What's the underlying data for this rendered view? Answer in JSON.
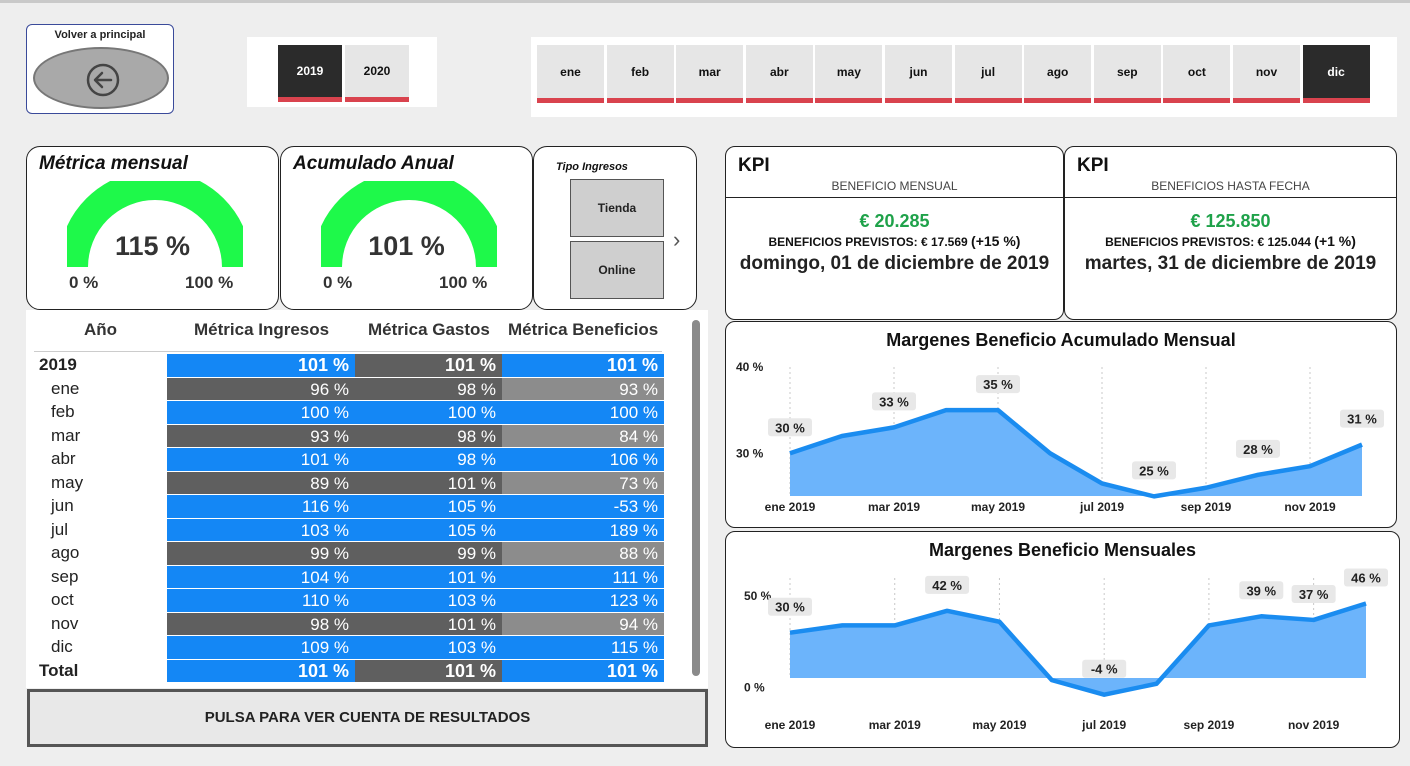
{
  "back": {
    "label": "Volver a principal"
  },
  "years": [
    {
      "label": "2019",
      "selected": true
    },
    {
      "label": "2020",
      "selected": false
    }
  ],
  "months": [
    {
      "label": "ene",
      "selected": false
    },
    {
      "label": "feb",
      "selected": false
    },
    {
      "label": "mar",
      "selected": false
    },
    {
      "label": "abr",
      "selected": false
    },
    {
      "label": "may",
      "selected": false
    },
    {
      "label": "jun",
      "selected": false
    },
    {
      "label": "jul",
      "selected": false
    },
    {
      "label": "ago",
      "selected": false
    },
    {
      "label": "sep",
      "selected": false
    },
    {
      "label": "oct",
      "selected": false
    },
    {
      "label": "nov",
      "selected": false
    },
    {
      "label": "dic",
      "selected": true
    }
  ],
  "gauges": [
    {
      "title": "Métrica mensual",
      "value": "115 %",
      "min": "0 %",
      "max": "100 %",
      "fill_fraction": 1.0
    },
    {
      "title": "Acumulado Anual",
      "value": "101 %",
      "min": "0 %",
      "max": "100 %",
      "fill_fraction": 1.0
    }
  ],
  "tipo": {
    "title": "Tipo Ingresos",
    "buttons": [
      "Tienda",
      "Online"
    ]
  },
  "table": {
    "headers": [
      "Año",
      "Métrica Ingresos",
      "Métrica Gastos",
      "Métrica Beneficios"
    ],
    "year_row": {
      "label": "2019",
      "values": [
        "101 %",
        "101 %",
        "101 %"
      ]
    },
    "rows": [
      {
        "label": "ene",
        "values": [
          "96 %",
          "98 %",
          "93 %"
        ]
      },
      {
        "label": "feb",
        "values": [
          "100 %",
          "100 %",
          "100 %"
        ]
      },
      {
        "label": "mar",
        "values": [
          "93 %",
          "98 %",
          "84 %"
        ]
      },
      {
        "label": "abr",
        "values": [
          "101 %",
          "98 %",
          "106 %"
        ]
      },
      {
        "label": "may",
        "values": [
          "89 %",
          "101 %",
          "73 %"
        ]
      },
      {
        "label": "jun",
        "values": [
          "116 %",
          "105 %",
          "-53 %"
        ]
      },
      {
        "label": "jul",
        "values": [
          "103 %",
          "105 %",
          "189 %"
        ]
      },
      {
        "label": "ago",
        "values": [
          "99 %",
          "99 %",
          "88 %"
        ]
      },
      {
        "label": "sep",
        "values": [
          "104 %",
          "101 %",
          "111 %"
        ]
      },
      {
        "label": "oct",
        "values": [
          "110 %",
          "103 %",
          "123 %"
        ]
      },
      {
        "label": "nov",
        "values": [
          "98 %",
          "101 %",
          "94 %"
        ]
      },
      {
        "label": "dic",
        "values": [
          "109 %",
          "103 %",
          "115 %"
        ]
      }
    ],
    "total_row": {
      "label": "Total",
      "values": [
        "101 %",
        "101 %",
        "101 %"
      ]
    }
  },
  "pulsa": {
    "label": "PULSA PARA VER CUENTA DE RESULTADOS"
  },
  "kpis": [
    {
      "head": "KPI",
      "sub": "BENEFICIO MENSUAL",
      "money": "€ 20.285",
      "prev_text": "BENEFICIOS PREVISTOS: € 17.569",
      "prev_pct": "(+15 %)",
      "date": "domingo, 01 de diciembre de 2019"
    },
    {
      "head": "KPI",
      "sub": "BENEFICIOS HASTA FECHA",
      "money": "€ 125.850",
      "prev_text": "BENEFICIOS PREVISTOS: € 125.044",
      "prev_pct": "(+1 %)",
      "date": "martes, 31 de diciembre de 2019"
    }
  ],
  "colors": {
    "accent_red": "#d9434e",
    "selected_dark": "#2b2b2b",
    "gauge_green": "#1ef94a",
    "money_green": "#1fa24a",
    "cell_blue": "#1487f5",
    "cell_dark": "#5f5f5f",
    "cell_gray": "#8c8c8c",
    "area_fill": "#6cb4fb",
    "line_blue": "#1a8cf0"
  },
  "chart_data": [
    {
      "type": "area",
      "title": "Margenes Beneficio Acumulado Mensual",
      "x": [
        "ene 2019",
        "feb 2019",
        "mar 2019",
        "abr 2019",
        "may 2019",
        "jun 2019",
        "jul 2019",
        "ago 2019",
        "sep 2019",
        "oct 2019",
        "nov 2019",
        "dic 2019"
      ],
      "x_tick_labels": [
        "ene 2019",
        "mar 2019",
        "may 2019",
        "jul 2019",
        "sep 2019",
        "nov 2019"
      ],
      "values": [
        30,
        32,
        33,
        35,
        35,
        30,
        26.5,
        25,
        26,
        27.5,
        28.5,
        31
      ],
      "data_labels": [
        {
          "index": 0,
          "text": "30 %"
        },
        {
          "index": 2,
          "text": "33 %"
        },
        {
          "index": 4,
          "text": "35 %"
        },
        {
          "index": 7,
          "text": "25 %"
        },
        {
          "index": 9,
          "text": "28 %"
        },
        {
          "index": 11,
          "text": "31 %"
        }
      ],
      "y_ticks": [
        {
          "value": 30,
          "label": "30 %"
        },
        {
          "value": 40,
          "label": "40 %"
        }
      ],
      "ylim": [
        24,
        40
      ]
    },
    {
      "type": "area",
      "title": "Margenes Beneficio Mensuales",
      "x": [
        "ene 2019",
        "feb 2019",
        "mar 2019",
        "abr 2019",
        "may 2019",
        "jun 2019",
        "jul 2019",
        "ago 2019",
        "sep 2019",
        "oct 2019",
        "nov 2019",
        "dic 2019"
      ],
      "x_tick_labels": [
        "ene 2019",
        "mar 2019",
        "may 2019",
        "jul 2019",
        "sep 2019",
        "nov 2019"
      ],
      "values": [
        30,
        34,
        34,
        42,
        36,
        4,
        -4,
        2,
        34,
        39,
        37,
        46
      ],
      "data_labels": [
        {
          "index": 0,
          "text": "30 %"
        },
        {
          "index": 3,
          "text": "42 %"
        },
        {
          "index": 6,
          "text": "-4 %"
        },
        {
          "index": 9,
          "text": "39 %"
        },
        {
          "index": 10,
          "text": "37 %"
        },
        {
          "index": 11,
          "text": "46 %"
        }
      ],
      "y_ticks": [
        {
          "value": 0,
          "label": "0 %"
        },
        {
          "value": 50,
          "label": "50 %"
        }
      ],
      "ylim": [
        -8,
        60
      ]
    }
  ]
}
